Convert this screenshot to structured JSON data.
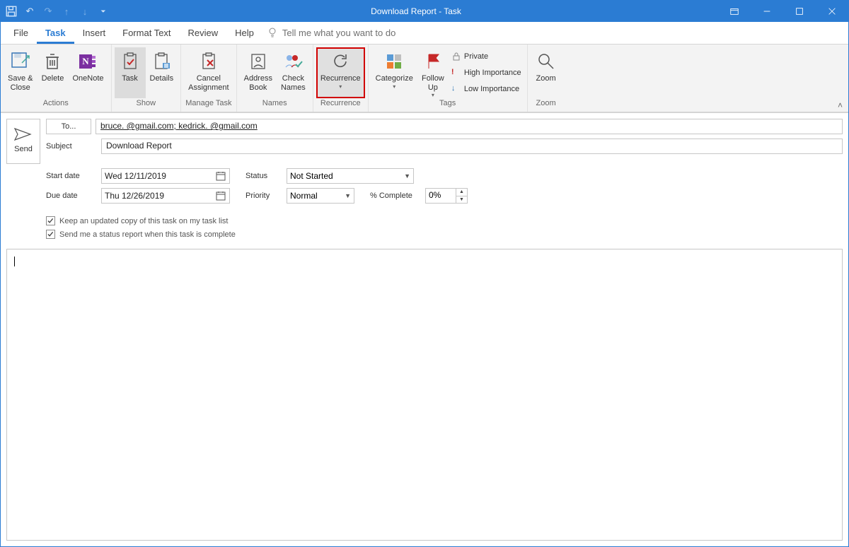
{
  "window": {
    "title": "Download Report  -  Task"
  },
  "tabs": {
    "file": "File",
    "task": "Task",
    "insert": "Insert",
    "format": "Format Text",
    "review": "Review",
    "help": "Help",
    "tell": "Tell me what you want to do"
  },
  "ribbon": {
    "save_close": "Save &\nClose",
    "delete": "Delete",
    "onenote": "OneNote",
    "actions_label": "Actions",
    "task": "Task",
    "details": "Details",
    "show_label": "Show",
    "cancel_assignment": "Cancel\nAssignment",
    "manage_label": "Manage Task",
    "address_book": "Address\nBook",
    "check_names": "Check\nNames",
    "names_label": "Names",
    "recurrence": "Recurrence",
    "recurrence_label": "Recurrence",
    "categorize": "Categorize",
    "followup": "Follow\nUp",
    "private": "Private",
    "high_imp": "High Importance",
    "low_imp": "Low Importance",
    "tags_label": "Tags",
    "zoom": "Zoom",
    "zoom_label": "Zoom"
  },
  "form": {
    "to_label": "To...",
    "to_value": "bruce.          @gmail.com; kedrick.          @gmail.com",
    "subject_label": "Subject",
    "subject_value": "Download Report",
    "start_label": "Start date",
    "start_value": "Wed 12/11/2019",
    "due_label": "Due date",
    "due_value": "Thu 12/26/2019",
    "status_label": "Status",
    "status_value": "Not Started",
    "priority_label": "Priority",
    "priority_value": "Normal",
    "complete_label": "% Complete",
    "complete_value": "0%",
    "send": "Send",
    "chk1": "Keep an updated copy of this task on my task list",
    "chk2": "Send me a status report when this task is complete"
  }
}
